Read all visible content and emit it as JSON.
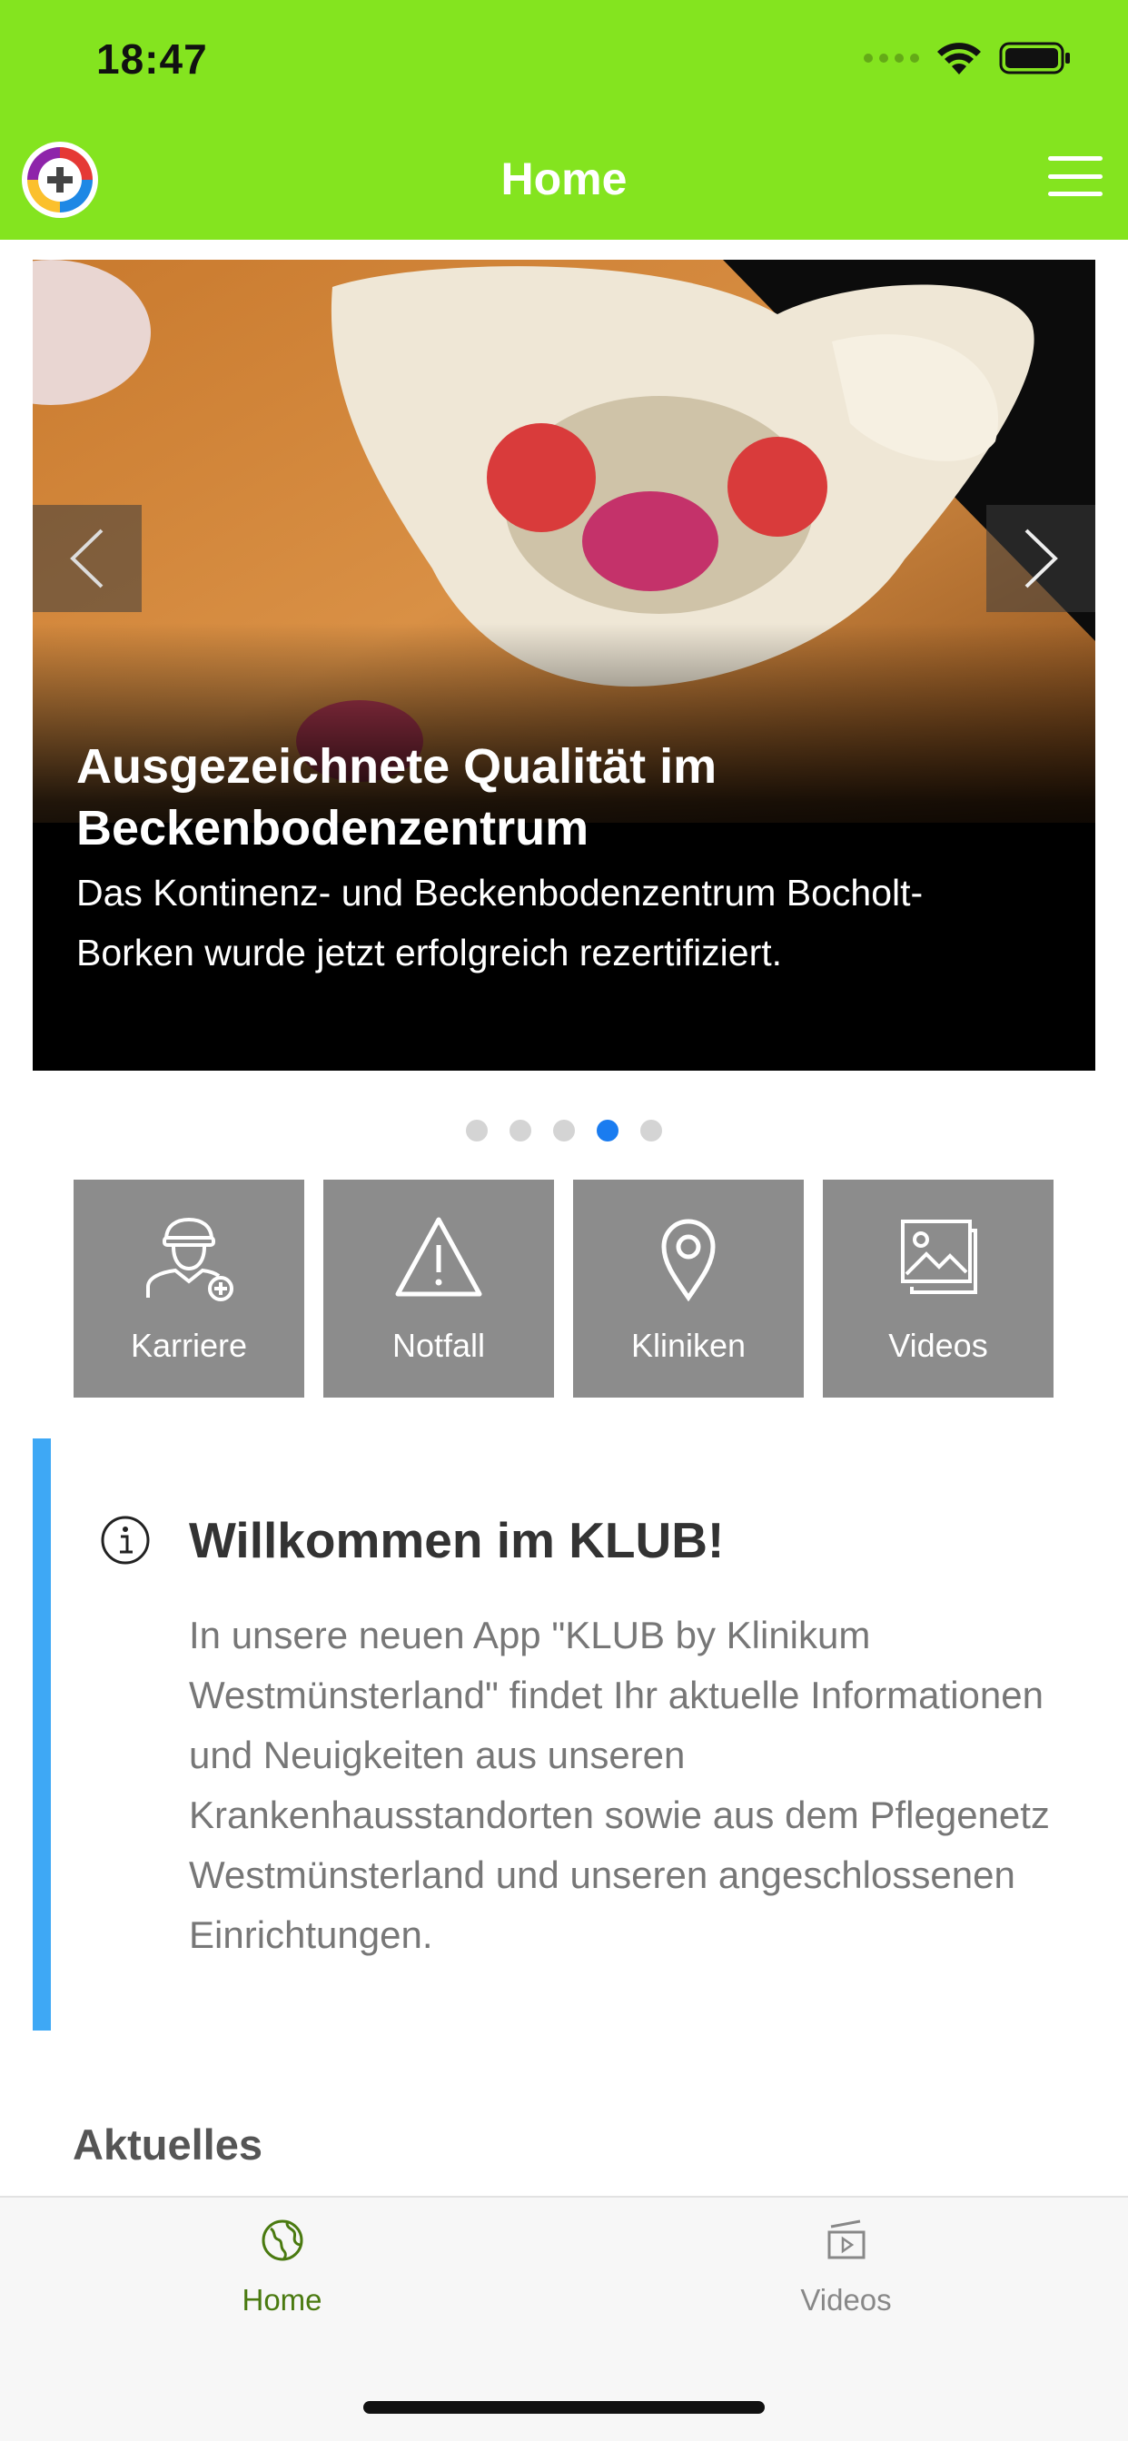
{
  "status_bar": {
    "time": "18:47"
  },
  "header": {
    "title": "Home",
    "logo_icon": "klub-logo-icon",
    "menu_icon": "hamburger-menu-icon",
    "background": "#84e41f"
  },
  "slider": {
    "title": "Ausgezeichnete Qualität im Beckenbodenzentrum",
    "text": "Das Kontinenz- und Beckenbodenzentrum Bocholt-Borken wurde jetzt erfolgreich rezertifiziert.",
    "slide_count": 5,
    "active_index": 4
  },
  "tiles": [
    {
      "label": "Karriere",
      "icon": "career-icon"
    },
    {
      "label": "Notfall",
      "icon": "warning-icon"
    },
    {
      "label": "Kliniken",
      "icon": "location-pin-icon"
    },
    {
      "label": "Videos",
      "icon": "gallery-icon"
    }
  ],
  "info": {
    "title": "Willkommen im KLUB!",
    "text": "In unsere neuen App \"KLUB by Klinikum Westmünsterland\" findet Ihr aktuelle Informationen und Neuigkeiten aus unseren Krankenhausstandorten sowie aus dem Pflegenetz Westmünsterland und unseren angeschlossenen Einrichtungen.",
    "accent": "#3ea8f5"
  },
  "section": {
    "title": "Aktuelles"
  },
  "tabbar": {
    "tabs": [
      {
        "label": "Home",
        "icon": "globe-icon",
        "active": true
      },
      {
        "label": "Videos",
        "icon": "video-icon",
        "active": false
      }
    ],
    "active_color": "#4a7a10"
  }
}
